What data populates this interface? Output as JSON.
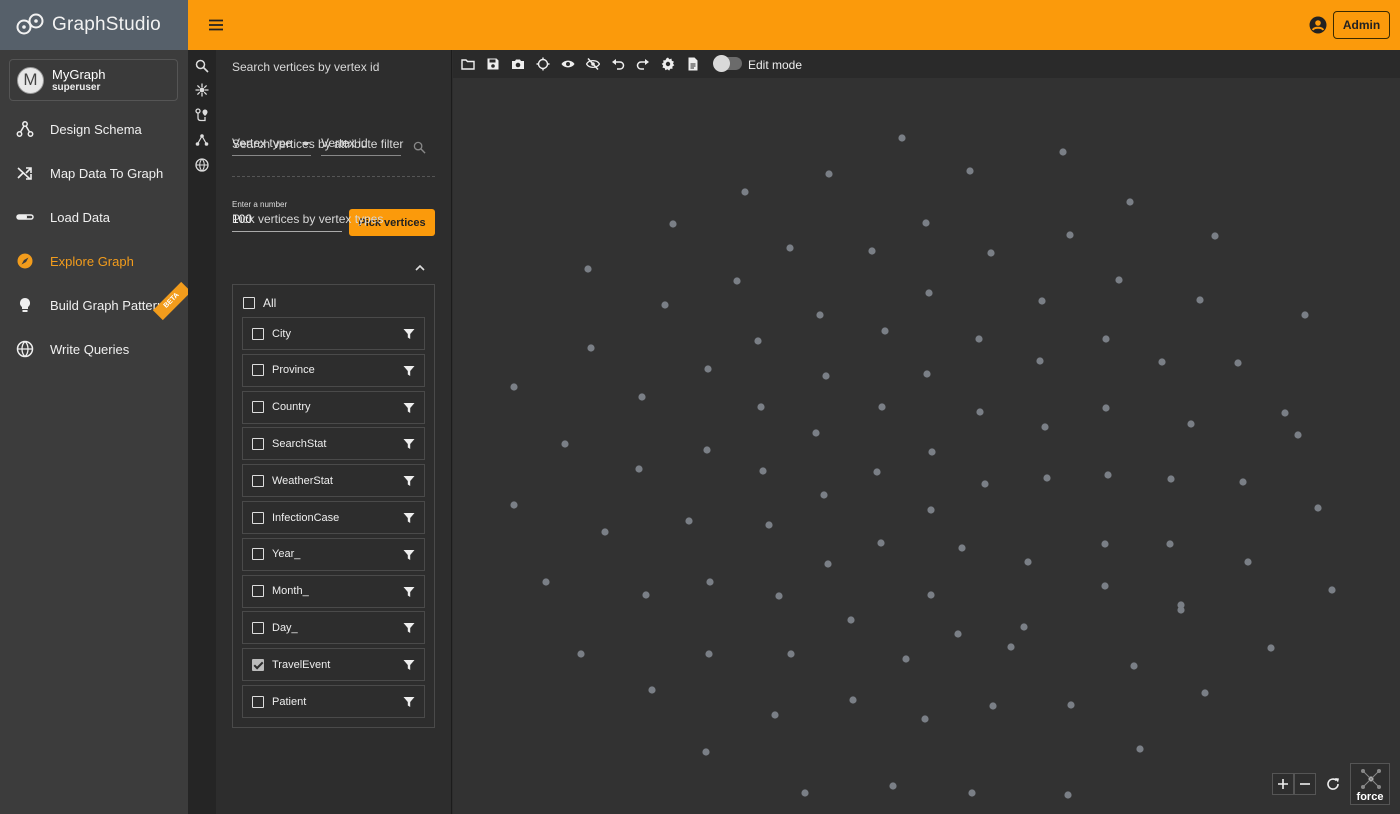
{
  "app": {
    "name": "GraphStudio"
  },
  "graph": {
    "avatar_letter": "M",
    "name": "MyGraph",
    "user": "superuser"
  },
  "nav": {
    "items": [
      {
        "label": "Design Schema",
        "icon": "schema-icon"
      },
      {
        "label": "Map Data To Graph",
        "icon": "shuffle-icon"
      },
      {
        "label": "Load Data",
        "icon": "load-data-icon"
      },
      {
        "label": "Explore Graph",
        "icon": "compass-icon",
        "active": true
      },
      {
        "label": "Build Graph Patterns",
        "icon": "lightbulb-icon",
        "badge": "BETA"
      },
      {
        "label": "Write Queries",
        "icon": "globe-icon"
      }
    ]
  },
  "header": {
    "admin_label": "Admin"
  },
  "search": {
    "by_id_heading": "Search vertices by vertex id",
    "vertex_type_placeholder": "Vertex type",
    "vertex_id_placeholder": "Vertex id",
    "by_attr_heading": "Search vertices by attribute filter",
    "number_label": "Enter a number",
    "number_value": "100",
    "pick_button": "Pick vertices",
    "by_type_heading": "Pick vertices by vertex types",
    "all_label": "All",
    "vertex_types": [
      {
        "label": "City",
        "checked": false
      },
      {
        "label": "Province",
        "checked": false
      },
      {
        "label": "Country",
        "checked": false
      },
      {
        "label": "SearchStat",
        "checked": false
      },
      {
        "label": "WeatherStat",
        "checked": false
      },
      {
        "label": "InfectionCase",
        "checked": false
      },
      {
        "label": "Year_",
        "checked": false
      },
      {
        "label": "Month_",
        "checked": false
      },
      {
        "label": "Day_",
        "checked": false
      },
      {
        "label": "TravelEvent",
        "checked": true
      },
      {
        "label": "Patient",
        "checked": false
      }
    ]
  },
  "toolbar": {
    "icons": [
      "open-icon",
      "save-icon",
      "screenshot-icon",
      "locate-icon",
      "show-icon",
      "hide-icon",
      "undo-icon",
      "redo-icon",
      "settings-icon",
      "document-icon"
    ],
    "edit_mode_label": "Edit mode",
    "edit_mode_on": false
  },
  "canvas": {
    "layout_label": "force",
    "node_color": "#7a7f86",
    "zoom_in": "+",
    "zoom_out": "−"
  },
  "colors": {
    "accent": "#fb9a0b",
    "nav_bg": "#3c3c3c",
    "canvas_bg": "#323232"
  }
}
